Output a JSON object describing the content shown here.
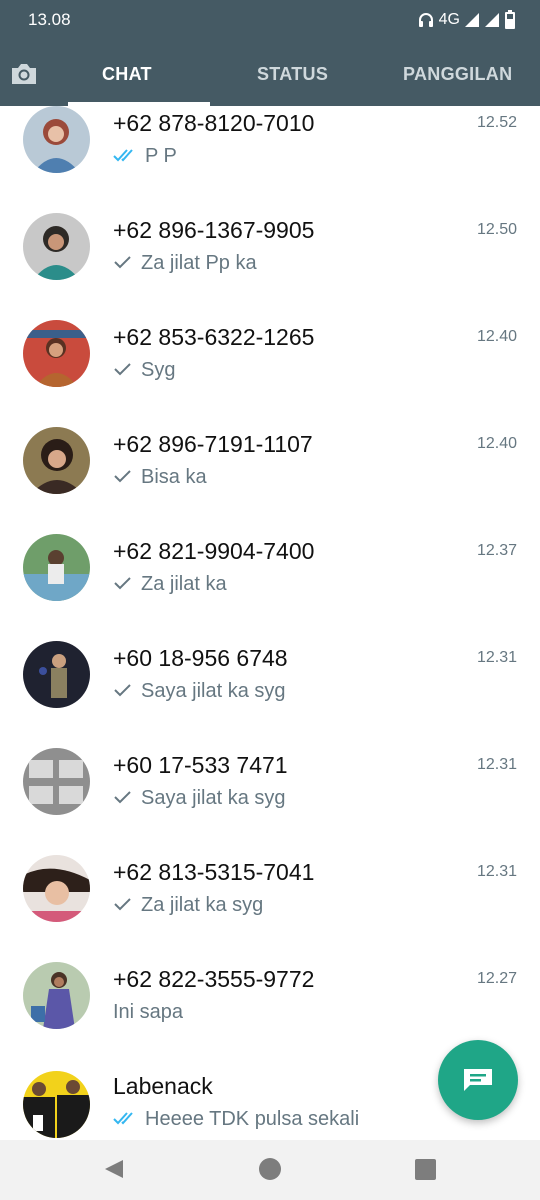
{
  "status_bar": {
    "time": "13.08",
    "network": "4G"
  },
  "tabs": [
    {
      "label": "CHAT",
      "active": true
    },
    {
      "label": "STATUS",
      "active": false
    },
    {
      "label": "PANGGILAN",
      "active": false
    }
  ],
  "chats": [
    {
      "name": "+62 878-8120-7010",
      "message": "P  P",
      "time": "12.52",
      "tick": "double-blue"
    },
    {
      "name": "+62 896-1367-9905",
      "message": "Za jilat Pp ka",
      "time": "12.50",
      "tick": "single"
    },
    {
      "name": "+62 853-6322-1265",
      "message": "Syg",
      "time": "12.40",
      "tick": "single"
    },
    {
      "name": "+62 896-7191-1107",
      "message": "Bisa ka",
      "time": "12.40",
      "tick": "single"
    },
    {
      "name": "+62 821-9904-7400",
      "message": "Za jilat ka",
      "time": "12.37",
      "tick": "single"
    },
    {
      "name": "+60 18-956 6748",
      "message": "Saya jilat ka syg",
      "time": "12.31",
      "tick": "single"
    },
    {
      "name": "+60 17-533 7471",
      "message": "Saya jilat ka syg",
      "time": "12.31",
      "tick": "single"
    },
    {
      "name": "+62 813-5315-7041",
      "message": "Za jilat ka syg",
      "time": "12.31",
      "tick": "single"
    },
    {
      "name": "+62 822-3555-9772",
      "message": "Ini sapa",
      "time": "12.27",
      "tick": "none"
    },
    {
      "name": "Labenack",
      "message": "Heeee TDK pulsa sekali",
      "time": "",
      "tick": "double-blue"
    }
  ],
  "colors": {
    "header": "#455a64",
    "accent": "#1fa687",
    "read_tick": "#34b7f1",
    "secondary_text": "#667781"
  },
  "icons": {
    "camera": "camera-icon",
    "fab": "new-message-icon",
    "nav": [
      "back-icon",
      "home-icon",
      "recents-icon"
    ]
  }
}
